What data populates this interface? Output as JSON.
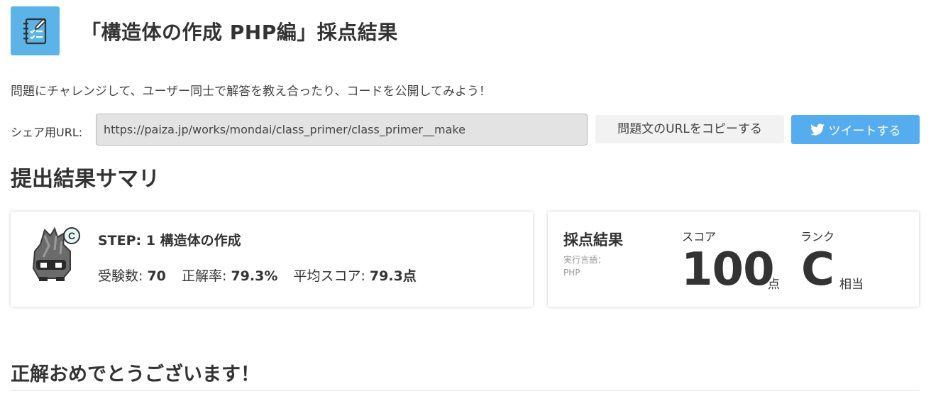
{
  "header": {
    "title": "「構造体の作成 PHP編」採点結果",
    "logo_icon": "checklist-notebook-icon",
    "logo_color": "#5bb3e8"
  },
  "description": "問題にチャレンジして、ユーザー同士で解答を教え合ったり、コードを公開してみよう！",
  "share": {
    "label": "シェア用URL:",
    "url": "https://paiza.jp/works/mondai/class_primer/class_primer__make",
    "copy_button": "問題文のURLをコピーする",
    "tweet_button": "ツイートする",
    "tweet_color": "#55acee"
  },
  "summary": {
    "title": "提出結果サマリ",
    "step_title": "STEP: 1 構造体の作成",
    "examinees_label": "受験数:",
    "examinees_value": "70",
    "accuracy_label": "正解率:",
    "accuracy_value": "79.3%",
    "avg_label": "平均スコア:",
    "avg_value": "79.3点",
    "rank_badge": "C"
  },
  "result": {
    "label": "採点結果",
    "language_label": "実行言語：",
    "language": "PHP",
    "score_label": "スコア",
    "score": "100",
    "score_unit": "点",
    "rank_label": "ランク",
    "rank": "C",
    "rank_unit": "相当"
  },
  "congrats": "正解おめでとうございます！"
}
